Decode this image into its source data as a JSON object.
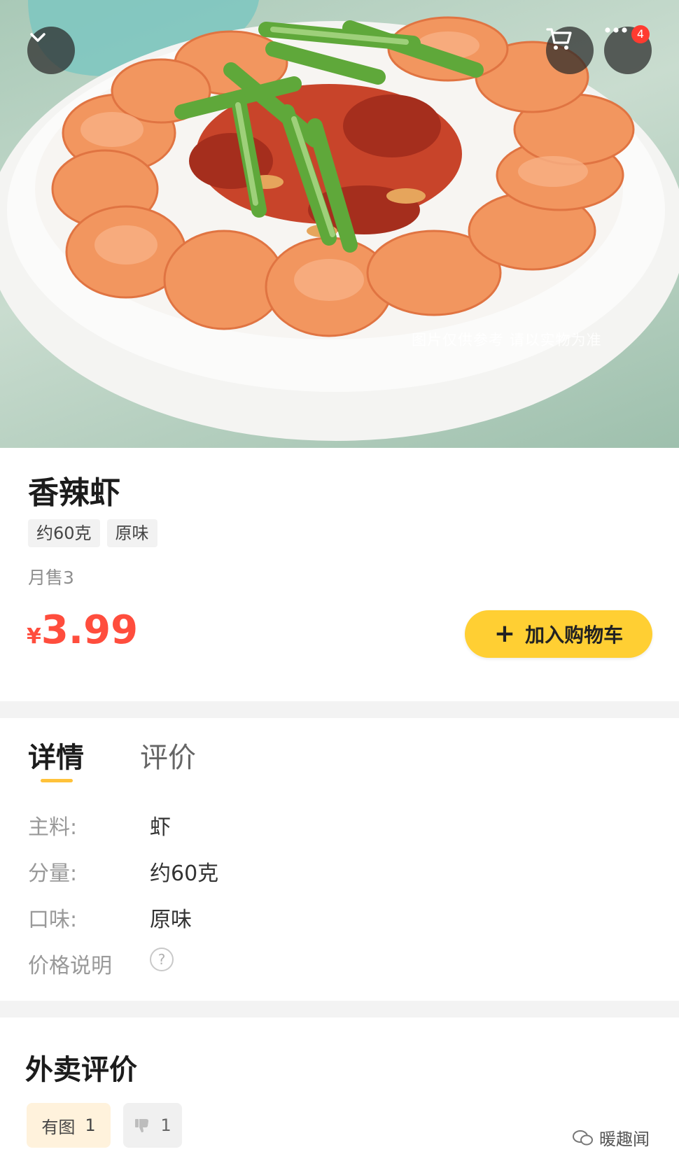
{
  "hero": {
    "watermark": "图片仅供参考 请以实物为准",
    "back_icon": "chevron-down-icon",
    "cart_icon": "cart-icon",
    "more_icon": "more-dots-icon",
    "more_badge": "4"
  },
  "product": {
    "name": "香辣虾",
    "tags": [
      "约60克",
      "原味"
    ],
    "monthly_sales": "月售3",
    "currency": "¥",
    "price": "3.99",
    "add_to_cart": "加入购物车"
  },
  "tabs": {
    "detail": "详情",
    "review": "评价"
  },
  "details": [
    {
      "label": "主料:",
      "value": "虾"
    },
    {
      "label": "分量:",
      "value": "约60克"
    },
    {
      "label": "口味:",
      "value": "原味"
    },
    {
      "label": "价格说明",
      "value": "?"
    }
  ],
  "reviews": {
    "title": "外卖评价",
    "filter_with_pic_label": "有图",
    "filter_with_pic_count": "1",
    "filter_bad_count": "1"
  },
  "watermark_account": "暖趣闻",
  "colors": {
    "price": "#ff4d3d",
    "cart_button": "#ffcf33",
    "tab_underline": "#ffc23a",
    "badge": "#ff3b30"
  }
}
